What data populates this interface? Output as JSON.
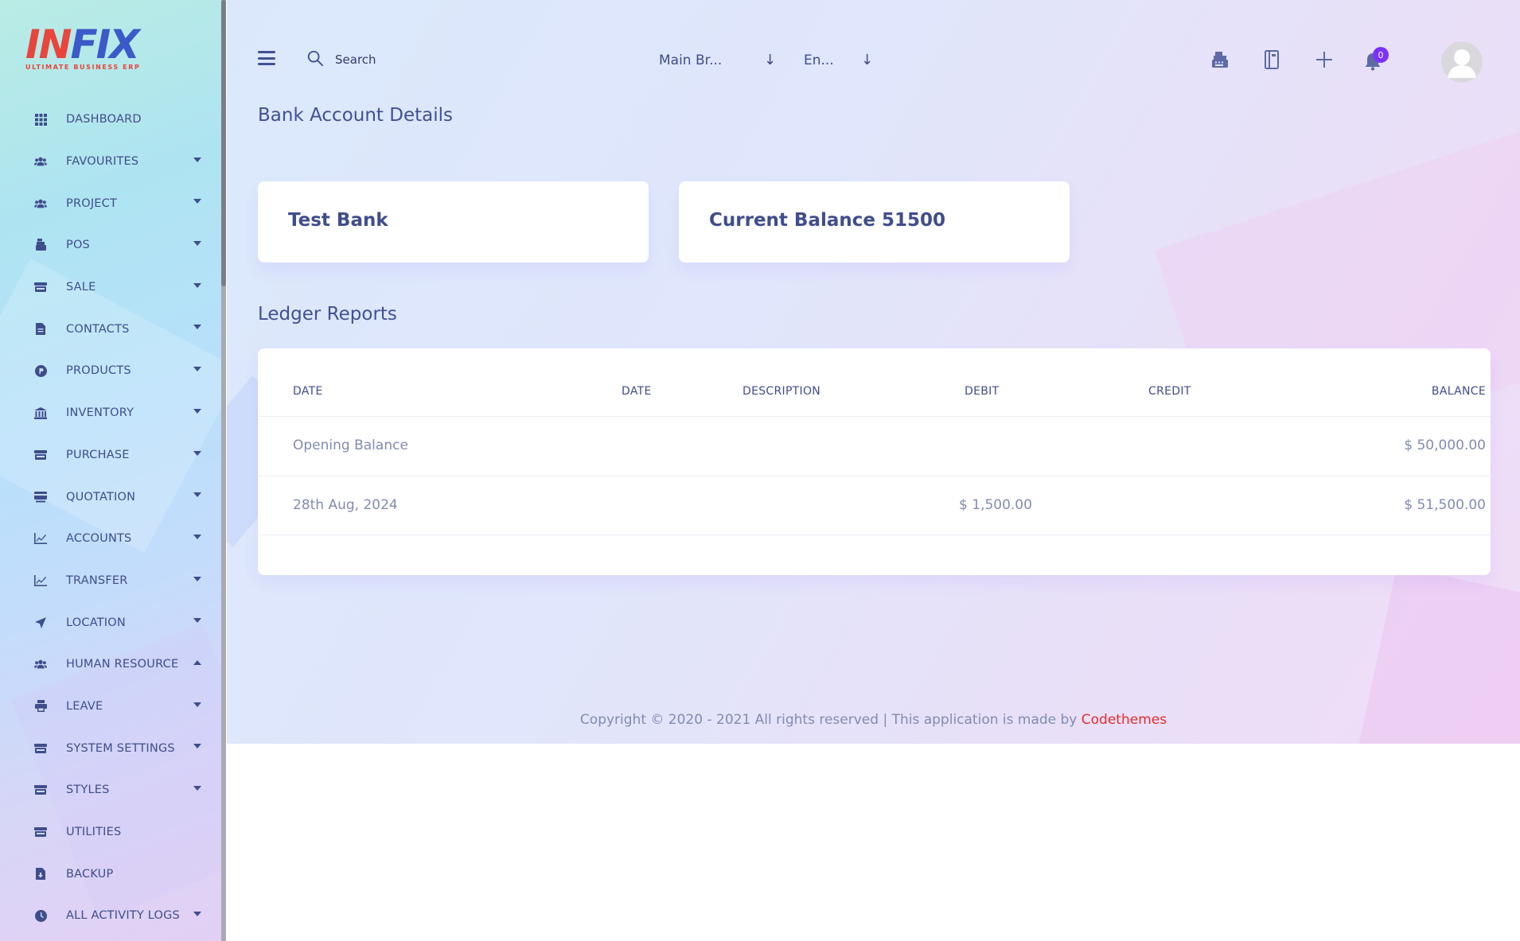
{
  "app": {
    "logo_text_1": "IN",
    "logo_text_2": "FIX",
    "logo_tagline": "ULTIMATE BUSINESS ERP"
  },
  "sidebar": {
    "items": [
      {
        "label": "DASHBOARD",
        "icon": "grid-icon",
        "caret": ""
      },
      {
        "label": "FAVOURITES",
        "icon": "users-icon",
        "caret": "down"
      },
      {
        "label": "PROJECT",
        "icon": "users-icon",
        "caret": "down"
      },
      {
        "label": "POS",
        "icon": "cash-register-icon",
        "caret": "down"
      },
      {
        "label": "SALE",
        "icon": "store-icon",
        "caret": "down"
      },
      {
        "label": "CONTACTS",
        "icon": "file-icon",
        "caret": "down"
      },
      {
        "label": "PRODUCTS",
        "icon": "product-icon",
        "caret": "down"
      },
      {
        "label": "INVENTORY",
        "icon": "bank-icon",
        "caret": "down"
      },
      {
        "label": "PURCHASE",
        "icon": "store-icon",
        "caret": "down"
      },
      {
        "label": "QUOTATION",
        "icon": "card-icon",
        "caret": "down"
      },
      {
        "label": "ACCOUNTS",
        "icon": "chart-icon",
        "caret": "down"
      },
      {
        "label": "TRANSFER",
        "icon": "chart-icon",
        "caret": "down"
      },
      {
        "label": "LOCATION",
        "icon": "location-arrow-icon",
        "caret": "down"
      },
      {
        "label": "HUMAN RESOURCE",
        "icon": "users-icon",
        "caret": "up"
      },
      {
        "label": "LEAVE",
        "icon": "printer-icon",
        "caret": "down"
      },
      {
        "label": "SYSTEM SETTINGS",
        "icon": "store-icon",
        "caret": "down"
      },
      {
        "label": "STYLES",
        "icon": "store-icon",
        "caret": "down"
      },
      {
        "label": "UTILITIES",
        "icon": "store-icon",
        "caret": ""
      },
      {
        "label": "BACKUP",
        "icon": "file-download-icon",
        "caret": ""
      },
      {
        "label": "ALL ACTIVITY LOGS",
        "icon": "clock-icon",
        "caret": "down"
      }
    ]
  },
  "header": {
    "search_placeholder": "Search",
    "branch_value": "Main Br...",
    "language_value": "En...",
    "notification_count": "0"
  },
  "page": {
    "title": "Bank Account Details",
    "bank_name": "Test Bank",
    "balance_text": "Current Balance 51500",
    "ledger_title": "Ledger Reports"
  },
  "ledger": {
    "columns": [
      "DATE",
      "DATE",
      "DESCRIPTION",
      "DEBIT",
      "CREDIT",
      "BALANCE"
    ],
    "rows": [
      {
        "date": "Opening Balance",
        "date2": "",
        "description": "",
        "debit": "",
        "credit": "",
        "balance": "$ 50,000.00"
      },
      {
        "date": "28th Aug, 2024",
        "date2": "",
        "description": "",
        "debit": "$ 1,500.00",
        "credit": "",
        "balance": "$ 51,500.00"
      }
    ]
  },
  "footer": {
    "text": "Copyright © 2020 - 2021 All rights reserved | This application is made by ",
    "link": "Codethemes"
  },
  "colors": {
    "primary": "#415094",
    "accent": "#7c32ff",
    "link": "#e02d2d",
    "muted": "#828bb2"
  }
}
